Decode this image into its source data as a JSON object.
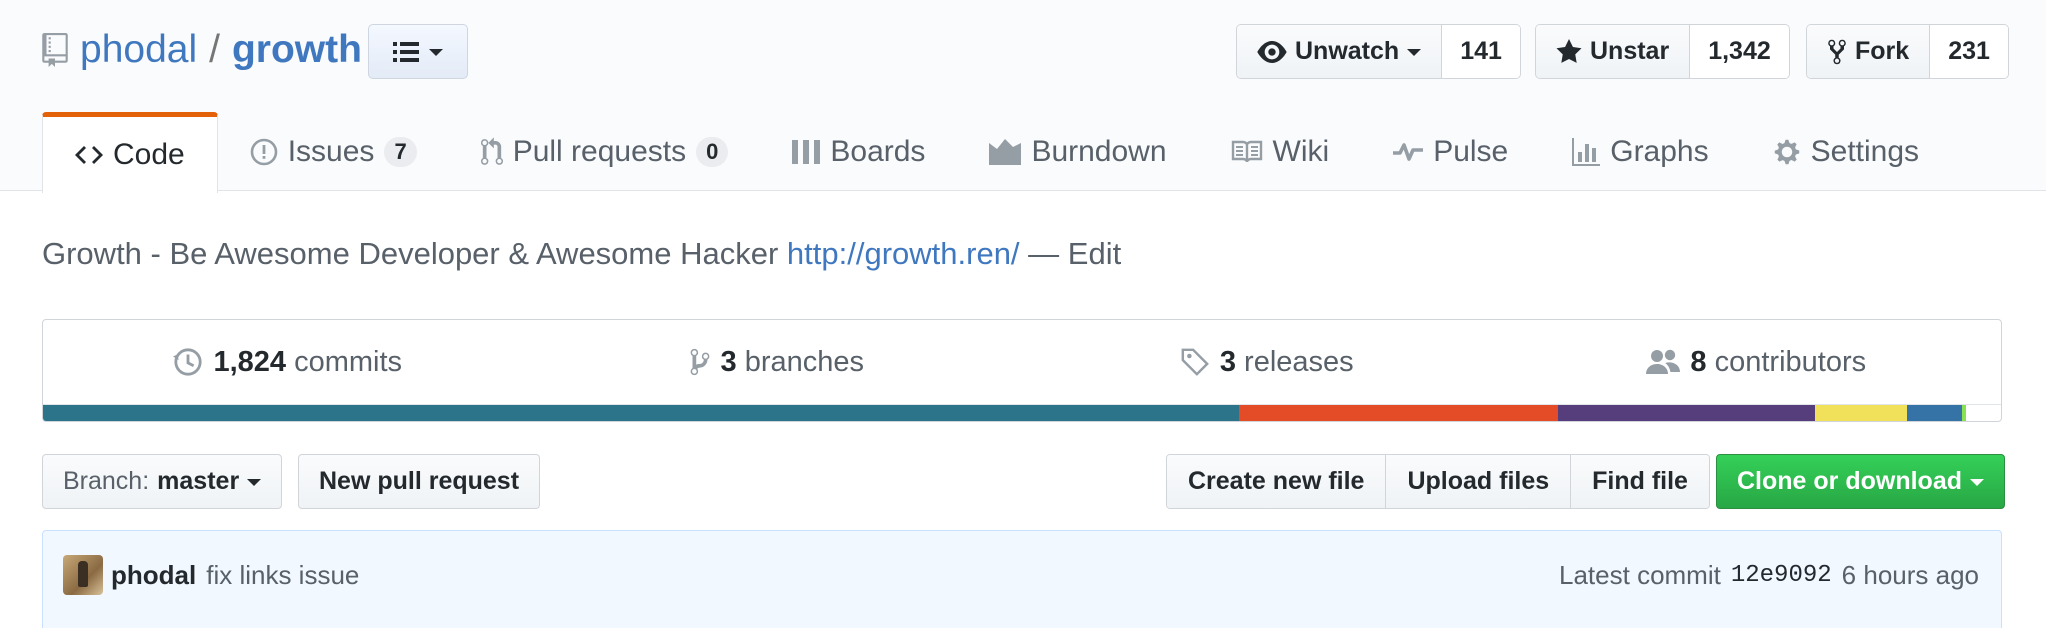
{
  "repo": {
    "owner": "phodal",
    "separator": "/",
    "name": "growth"
  },
  "social": {
    "watch_label": "Unwatch",
    "watch_count": "141",
    "star_label": "Unstar",
    "star_count": "1,342",
    "fork_label": "Fork",
    "fork_count": "231"
  },
  "tabs": [
    {
      "label": "Code",
      "icon": "code-icon",
      "selected": true
    },
    {
      "label": "Issues",
      "icon": "issue-icon",
      "counter": "7"
    },
    {
      "label": "Pull requests",
      "icon": "pull-request-icon",
      "counter": "0"
    },
    {
      "label": "Boards",
      "icon": "boards-icon"
    },
    {
      "label": "Burndown",
      "icon": "burndown-icon"
    },
    {
      "label": "Wiki",
      "icon": "book-icon"
    },
    {
      "label": "Pulse",
      "icon": "pulse-icon"
    },
    {
      "label": "Graphs",
      "icon": "graph-icon"
    },
    {
      "label": "Settings",
      "icon": "gear-icon"
    }
  ],
  "description": {
    "text": "Growth - Be Awesome Developer & Awesome Hacker",
    "link": "http://growth.ren/",
    "edit_separator": "—",
    "edit_label": "Edit"
  },
  "summary": {
    "commits_count": "1,824",
    "commits_label": "commits",
    "branches_count": "3",
    "branches_label": "branches",
    "releases_count": "3",
    "releases_label": "releases",
    "contributors_count": "8",
    "contributors_label": "contributors"
  },
  "language_bar": [
    {
      "color": "#2b7489",
      "percent": 61.1
    },
    {
      "color": "#e34c26",
      "percent": 16.3
    },
    {
      "color": "#563d7c",
      "percent": 13.1
    },
    {
      "color": "#f1e05a",
      "percent": 4.7
    },
    {
      "color": "#3572a5",
      "percent": 2.8
    },
    {
      "color": "#89e051",
      "percent": 0.2
    }
  ],
  "file_nav": {
    "branch_prefix": "Branch:",
    "branch_name": "master",
    "new_pull_request": "New pull request",
    "create_new_file": "Create new file",
    "upload_files": "Upload files",
    "find_file": "Find file",
    "clone_or_download": "Clone or download"
  },
  "commit": {
    "author": "phodal",
    "message": "fix links issue",
    "latest_label": "Latest commit",
    "sha": "12e9092",
    "time": "6 hours ago"
  },
  "colors": {
    "link": "#4078c0",
    "selected_tab_accent": "#e36209",
    "clone_button": "#28a745"
  }
}
